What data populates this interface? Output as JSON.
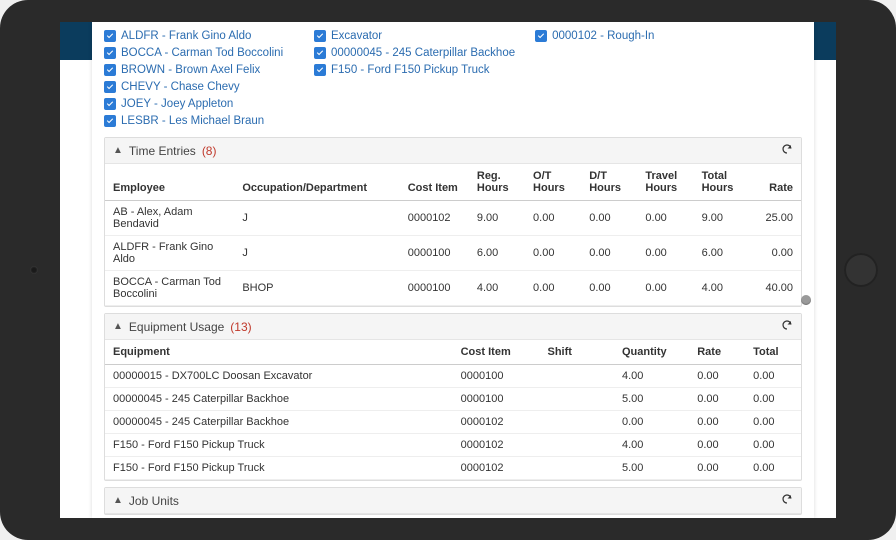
{
  "employees_checks": [
    "ALDFR - Frank Gino Aldo",
    "BOCCA - Carman Tod Boccolini",
    "BROWN - Brown Axel Felix",
    "CHEVY - Chase Chevy",
    "JOEY - Joey Appleton",
    "LESBR - Les Michael Braun"
  ],
  "equipment_checks": [
    "Excavator",
    "00000045 - 245 Caterpillar Backhoe",
    "F150 - Ford F150 Pickup Truck"
  ],
  "cost_checks": [
    "0000102 - Rough-In"
  ],
  "sections": {
    "time_entries": {
      "title": "Time Entries",
      "count": "(8)"
    },
    "equip_usage": {
      "title": "Equipment Usage",
      "count": "(13)"
    },
    "job_units": {
      "title": "Job Units",
      "count": ""
    }
  },
  "time_headers": {
    "employee": "Employee",
    "occdept": "Occupation/Department",
    "costitem": "Cost Item",
    "reg": "Reg. Hours",
    "ot": "O/T Hours",
    "dt": "D/T Hours",
    "travel": "Travel Hours",
    "total": "Total Hours",
    "rate": "Rate"
  },
  "time_rows": [
    {
      "emp": "AB - Alex, Adam Bendavid",
      "occ": "J",
      "ci": "0000102",
      "reg": "9.00",
      "ot": "0.00",
      "dt": "0.00",
      "tr": "0.00",
      "tot": "9.00",
      "rate": "25.00"
    },
    {
      "emp": "ALDFR - Frank Gino Aldo",
      "occ": "J",
      "ci": "0000100",
      "reg": "6.00",
      "ot": "0.00",
      "dt": "0.00",
      "tr": "0.00",
      "tot": "6.00",
      "rate": "0.00"
    },
    {
      "emp": "BOCCA - Carman Tod Boccolini",
      "occ": "BHOP",
      "ci": "0000100",
      "reg": "4.00",
      "ot": "0.00",
      "dt": "0.00",
      "tr": "0.00",
      "tot": "4.00",
      "rate": "40.00"
    }
  ],
  "equip_headers": {
    "equipment": "Equipment",
    "costitem": "Cost Item",
    "shift": "Shift",
    "qty": "Quantity",
    "rate": "Rate",
    "total": "Total"
  },
  "equip_rows": [
    {
      "eq": "00000015 - DX700LC Doosan Excavator",
      "ci": "0000100",
      "sh": "",
      "qty": "4.00",
      "rate": "0.00",
      "tot": "0.00"
    },
    {
      "eq": "00000045 - 245 Caterpillar Backhoe",
      "ci": "0000100",
      "sh": "",
      "qty": "5.00",
      "rate": "0.00",
      "tot": "0.00"
    },
    {
      "eq": "00000045 - 245 Caterpillar Backhoe",
      "ci": "0000102",
      "sh": "",
      "qty": "0.00",
      "rate": "0.00",
      "tot": "0.00"
    },
    {
      "eq": "F150 - Ford F150 Pickup Truck",
      "ci": "0000102",
      "sh": "",
      "qty": "4.00",
      "rate": "0.00",
      "tot": "0.00"
    },
    {
      "eq": "F150 - Ford F150 Pickup Truck",
      "ci": "0000102",
      "sh": "",
      "qty": "5.00",
      "rate": "0.00",
      "tot": "0.00"
    }
  ]
}
